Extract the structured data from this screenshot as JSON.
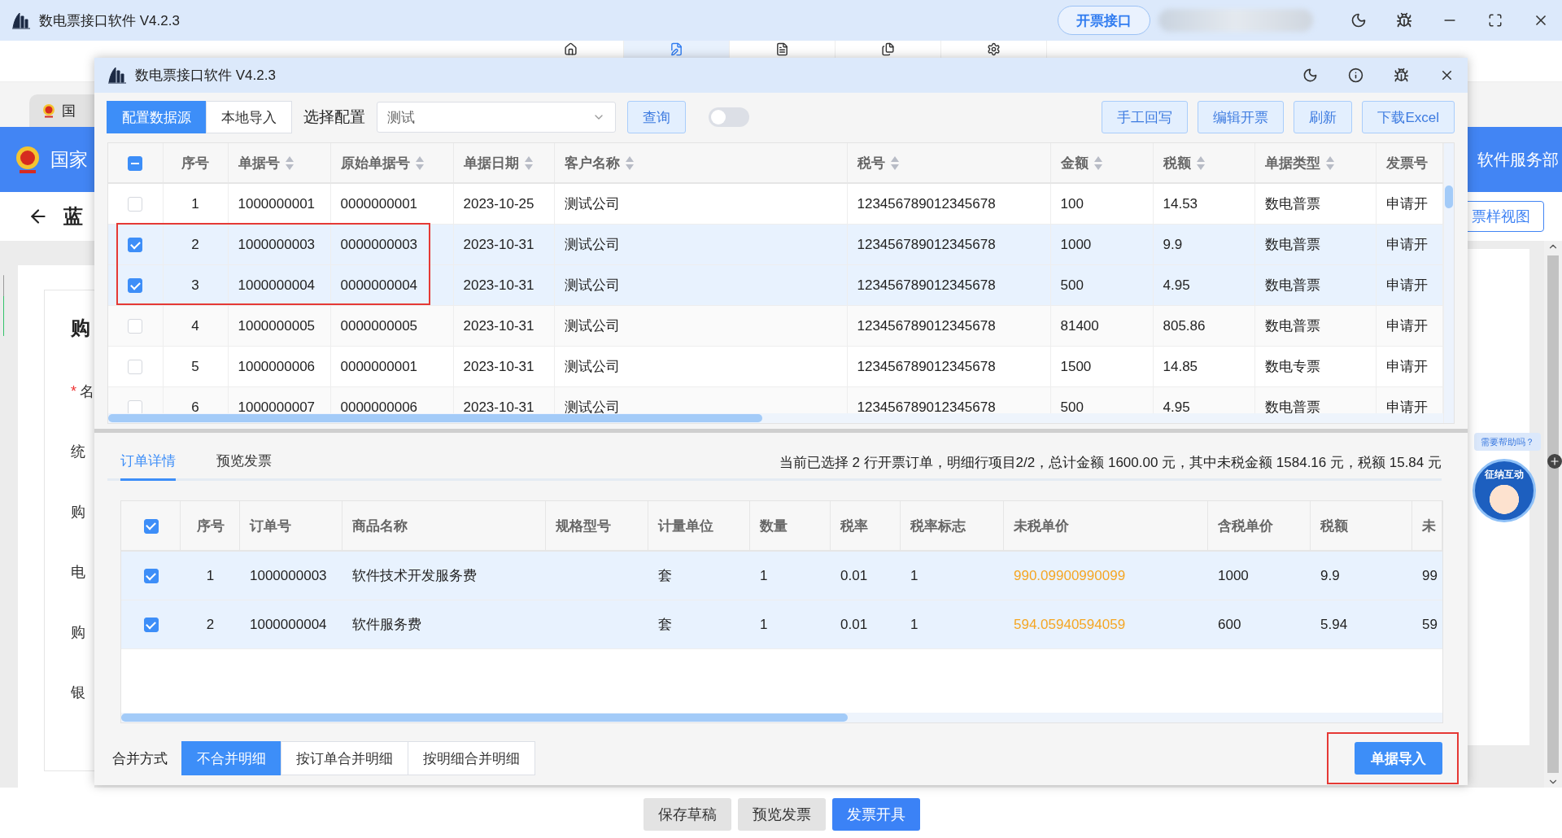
{
  "app": {
    "title": "数电票接口软件 V4.2.3",
    "api_button": "开票接口",
    "nav": [
      {
        "selected": false
      },
      {
        "selected": true
      },
      {
        "selected": false
      },
      {
        "selected": false
      },
      {
        "selected": false
      }
    ]
  },
  "background": {
    "browser_tab": "国",
    "banner_left": "国家",
    "banner_right": "软件服务部",
    "page_title": "蓝",
    "sample_view_button": "票样视图",
    "form_heading": "购",
    "form_labels": [
      {
        "marker": "*",
        "label": "名"
      },
      {
        "label": "统"
      },
      {
        "label": "购"
      },
      {
        "label": "电"
      },
      {
        "label": "购"
      },
      {
        "label": "银"
      }
    ],
    "help_bubble": "需要帮助吗？",
    "mascot": "征纳互动",
    "footer_buttons": [
      {
        "label": "保存草稿",
        "primary": false
      },
      {
        "label": "预览发票",
        "primary": false
      },
      {
        "label": "发票开具",
        "primary": true
      }
    ]
  },
  "dialog": {
    "title": "数电票接口软件 V4.2.3",
    "source_tabs": [
      {
        "label": "配置数据源",
        "selected": true
      },
      {
        "label": "本地导入",
        "selected": false
      }
    ],
    "config_label": "选择配置",
    "config_value": "测试",
    "query_button": "查询",
    "toggle_on": false,
    "actions": [
      "手工回写",
      "编辑开票",
      "刷新",
      "下载Excel"
    ],
    "orders": {
      "header_indeterminate": true,
      "columns": [
        {
          "label": "序号",
          "sortable": false
        },
        {
          "label": "单据号",
          "sortable": true
        },
        {
          "label": "原始单据号",
          "sortable": true
        },
        {
          "label": "单据日期",
          "sortable": true
        },
        {
          "label": "客户名称",
          "sortable": true
        },
        {
          "label": "税号",
          "sortable": true
        },
        {
          "label": "金额",
          "sortable": true
        },
        {
          "label": "税额",
          "sortable": true
        },
        {
          "label": "单据类型",
          "sortable": true
        },
        {
          "label": "发票号",
          "sortable": false
        }
      ],
      "rows": [
        {
          "selected": false,
          "cells": [
            "1",
            "1000000001",
            "0000000001",
            "2023-10-25",
            "测试公司",
            "123456789012345678",
            "100",
            "14.53",
            "数电普票",
            "申请开"
          ]
        },
        {
          "selected": true,
          "cells": [
            "2",
            "1000000003",
            "0000000003",
            "2023-10-31",
            "测试公司",
            "123456789012345678",
            "1000",
            "9.9",
            "数电普票",
            "申请开"
          ]
        },
        {
          "selected": true,
          "cells": [
            "3",
            "1000000004",
            "0000000004",
            "2023-10-31",
            "测试公司",
            "123456789012345678",
            "500",
            "4.95",
            "数电普票",
            "申请开"
          ]
        },
        {
          "selected": false,
          "cells": [
            "4",
            "1000000005",
            "0000000005",
            "2023-10-31",
            "测试公司",
            "123456789012345678",
            "81400",
            "805.86",
            "数电普票",
            "申请开"
          ]
        },
        {
          "selected": false,
          "cells": [
            "5",
            "1000000006",
            "0000000001",
            "2023-10-31",
            "测试公司",
            "123456789012345678",
            "1500",
            "14.85",
            "数电专票",
            "申请开"
          ]
        },
        {
          "selected": false,
          "cells": [
            "6",
            "1000000007",
            "0000000006",
            "2023-10-31",
            "测试公司",
            "123456789012345678",
            "500",
            "4.95",
            "数电普票",
            "申请开"
          ]
        }
      ]
    },
    "detail_tabs": [
      {
        "label": "订单详情",
        "selected": true
      },
      {
        "label": "预览发票",
        "selected": false
      }
    ],
    "summary": "当前已选择 2 行开票订单，明细行项目2/2，总计金额 1600.00 元，其中未税金额 1584.16 元，税额 15.84 元",
    "details": {
      "header_checked": true,
      "columns": [
        {
          "label": "序号"
        },
        {
          "label": "订单号"
        },
        {
          "label": "商品名称"
        },
        {
          "label": "规格型号"
        },
        {
          "label": "计量单位"
        },
        {
          "label": "数量"
        },
        {
          "label": "税率"
        },
        {
          "label": "税率标志"
        },
        {
          "label": "未税单价",
          "emphasis": true
        },
        {
          "label": "含税单价"
        },
        {
          "label": "税额"
        },
        {
          "label": "未"
        }
      ],
      "rows": [
        {
          "checked": true,
          "cells": [
            "1",
            "1000000003",
            "软件技术开发服务费",
            "",
            "套",
            "1",
            "0.01",
            "1",
            "990.09900990099",
            "1000",
            "9.9",
            "99"
          ]
        },
        {
          "checked": true,
          "cells": [
            "2",
            "1000000004",
            "软件服务费",
            "",
            "套",
            "1",
            "0.01",
            "1",
            "594.05940594059",
            "600",
            "5.94",
            "59"
          ]
        }
      ]
    },
    "merge_label": "合并方式",
    "merge_options": [
      {
        "label": "不合并明细",
        "selected": true
      },
      {
        "label": "按订单合并明细",
        "selected": false
      },
      {
        "label": "按明细合并明细",
        "selected": false
      }
    ],
    "import_button": "单据导入"
  }
}
